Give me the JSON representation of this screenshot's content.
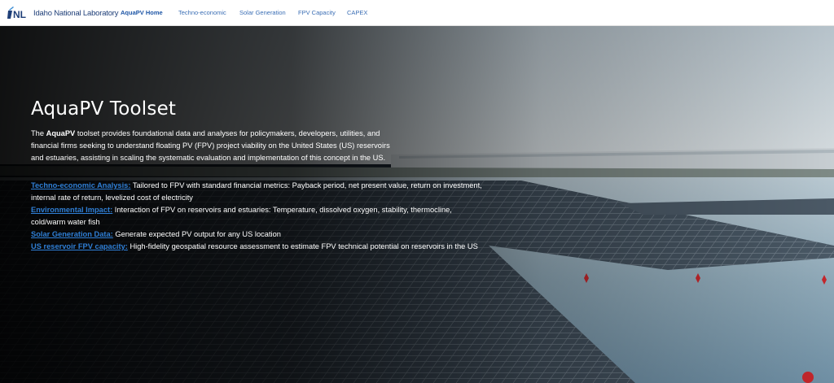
{
  "header": {
    "logo_text": "Idaho National Laboratory",
    "nav": [
      {
        "label": "AquaPV Home",
        "active": true
      },
      {
        "label": "Techno-economic",
        "active": false
      },
      {
        "label": "Solar Generation",
        "active": false
      },
      {
        "label": "FPV Capacity",
        "active": false
      },
      {
        "label": "CAPEX",
        "active": false
      }
    ]
  },
  "hero": {
    "title": "AquaPV Toolset",
    "intro": {
      "prefix": "The ",
      "bold": "AquaPV",
      "text": " toolset provides foundational data and analyses for policymakers, developers, utilities, and financial firms seeking to understand floating PV (FPV) project viability on the United States (US) reservoirs and estuaries, assisting in scaling the systematic evaluation and implementation of this concept in the US."
    },
    "features": [
      {
        "link": "Techno-economic Analysis:",
        "text": " Tailored to FPV with standard financial metrics: Payback period, net present value, return on investment, internal rate of return, levelized cost of electricity"
      },
      {
        "link": "Environmental Impact:",
        "text": " Interaction of FPV on reservoirs and estuaries: Temperature, dissolved oxygen, stability, thermocline, cold/warm water fish"
      },
      {
        "link": "Solar Generation Data:",
        "text": " Generate expected PV output for any US location"
      },
      {
        "link": "US reservoir FPV capacity:",
        "text": " High-fidelity geospatial resource assessment to estimate FPV technical potential on reservoirs in the US"
      }
    ]
  },
  "colors": {
    "link": "#2f7fd6",
    "nav_link": "#3c6fb5",
    "brand_blue": "#1f3f78"
  }
}
